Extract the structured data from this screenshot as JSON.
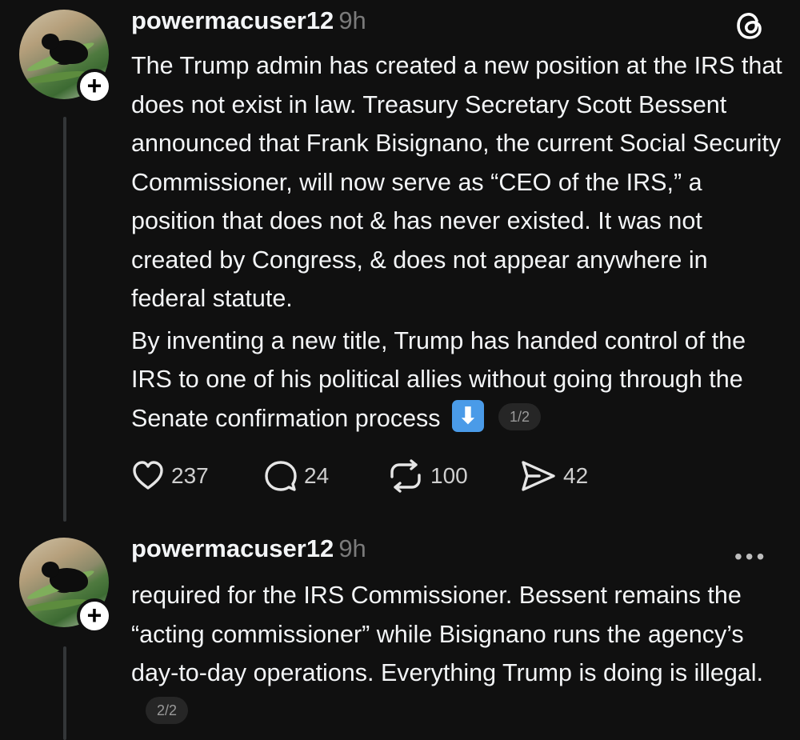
{
  "posts": [
    {
      "username": "powermacuser12",
      "time": "9h",
      "paragraphs": [
        "The Trump admin has created a new position at the IRS that does not exist in law. Treasury Secretary Scott Bessent announced that Frank Bisignano, the current Social Security Commissioner, will now serve as “CEO of the IRS,” a position that does not & has never existed. It was not created by Congress, & does not appear anywhere in federal statute.",
        "By inventing a new title, Trump has handed control of the IRS to one of his political allies without going through the Senate confirmation process"
      ],
      "emoji": "⬇",
      "pager": "1/2",
      "stats": {
        "likes": "237",
        "replies": "24",
        "reposts": "100",
        "shares": "42"
      }
    },
    {
      "username": "powermacuser12",
      "time": "9h",
      "paragraphs": [
        "required for the IRS Commissioner. Bessent remains the “acting commissioner” while Bisignano runs the agency’s day-to-day operations. Everything Trump is doing is illegal."
      ],
      "pager": "2/2"
    }
  ],
  "icons": {
    "app_logo": "threads-logo-icon",
    "more": "more-options-icon",
    "more_glyph": "•••",
    "plus_glyph": "+"
  }
}
